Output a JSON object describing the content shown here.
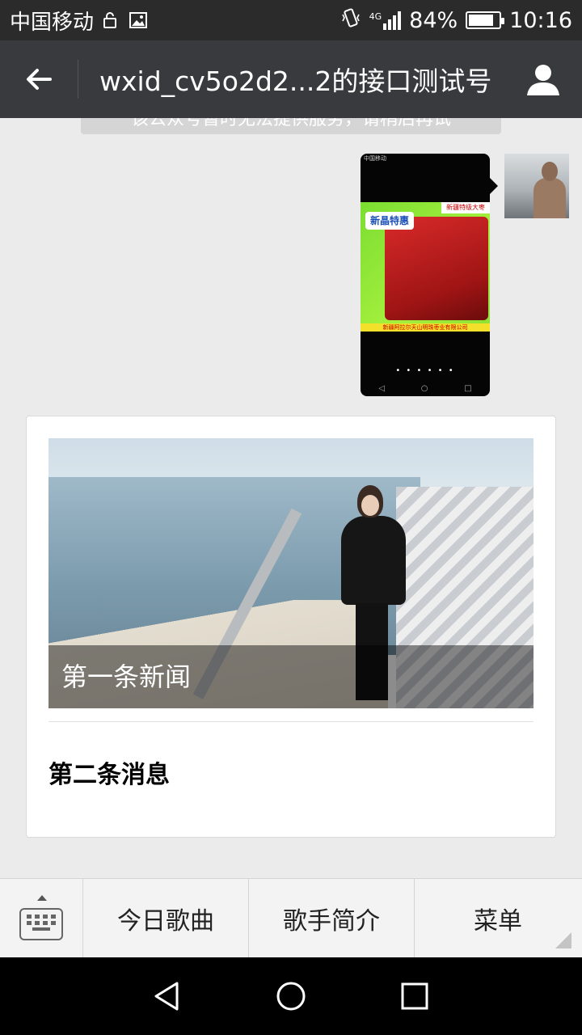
{
  "status_bar": {
    "carrier": "中国移动",
    "network": "4G",
    "battery_percent": "84%",
    "battery_level": 0.84,
    "time": "10:16"
  },
  "title_bar": {
    "title": "wxid_cv5o2d2...2的接口测试号"
  },
  "notice": {
    "text": "该公众号暂时无法提供服务，请稍后再试"
  },
  "message_image": {
    "phone_carrier": "中国移动",
    "brand_text": "新晶特惠",
    "top_strip": "新疆特级大枣",
    "footer_strip": "新疆阿拉尔天山明珠枣业有限公司",
    "dots": "• • • • • •"
  },
  "news": {
    "item1_title": "第一条新闻",
    "item2_title": "第二条消息"
  },
  "menu": {
    "items": [
      {
        "label": "今日歌曲"
      },
      {
        "label": "歌手简介"
      },
      {
        "label": "菜单"
      }
    ]
  },
  "colors": {
    "title_bar": "#393a3e",
    "status_bar": "#2b2b2b",
    "background": "#ebebeb"
  }
}
